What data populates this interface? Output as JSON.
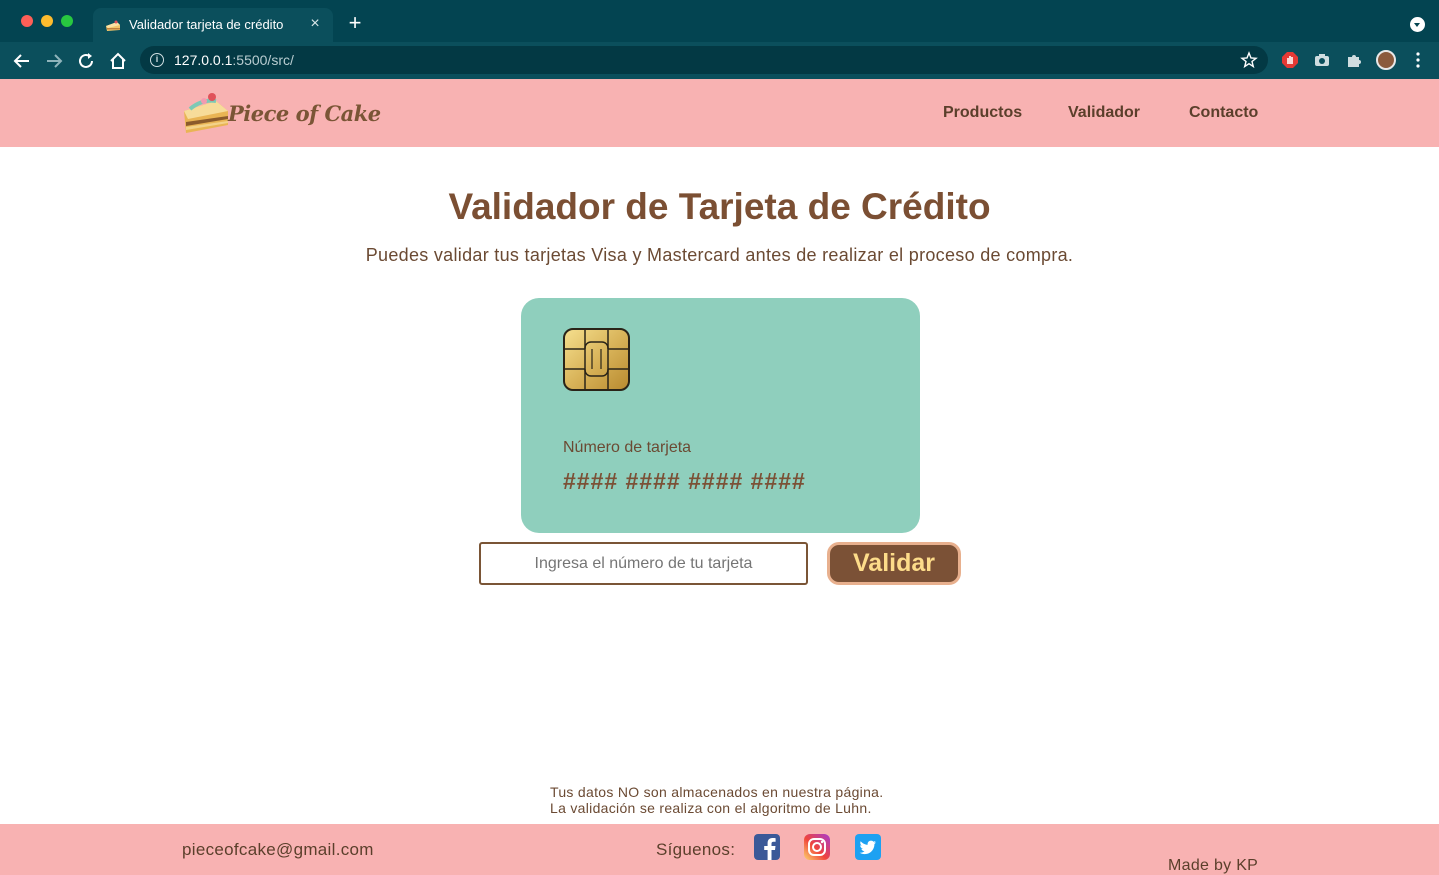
{
  "browser": {
    "tab_title": "Validador tarjeta de crédito",
    "tab_close": "×",
    "new_tab": "+",
    "url_host": "127.0.0.1",
    "url_rest": ":5500/src/"
  },
  "header": {
    "logo_text": "Piece of Cake",
    "nav": {
      "products": "Productos",
      "validator": "Validador",
      "contact": "Contacto"
    }
  },
  "main": {
    "title": "Validador de Tarjeta de Crédito",
    "subtitle": "Puedes validar tus tarjetas Visa y Mastercard antes de realizar el proceso de compra.",
    "card": {
      "label": "Número de tarjeta",
      "number": "#### #### #### ####"
    },
    "input": {
      "placeholder": "Ingresa el número de tu tarjeta",
      "value": ""
    },
    "validate_label": "Validar",
    "disclaimer": {
      "line1": "Tus datos NO son almacenados en nuestra página.",
      "line2": "La validación se realiza con el algoritmo de Luhn."
    }
  },
  "footer": {
    "email": "pieceofcake@gmail.com",
    "follow_label": "Síguenos:",
    "social": [
      "facebook-icon",
      "instagram-icon",
      "twitter-icon"
    ],
    "credit": "Made by KP"
  },
  "colors": {
    "header_bg": "#f8b2b2",
    "brown": "#7b5136",
    "card_bg": "#8fcfbd",
    "button_text": "#fddc8a",
    "chrome_bg": "#034451"
  }
}
